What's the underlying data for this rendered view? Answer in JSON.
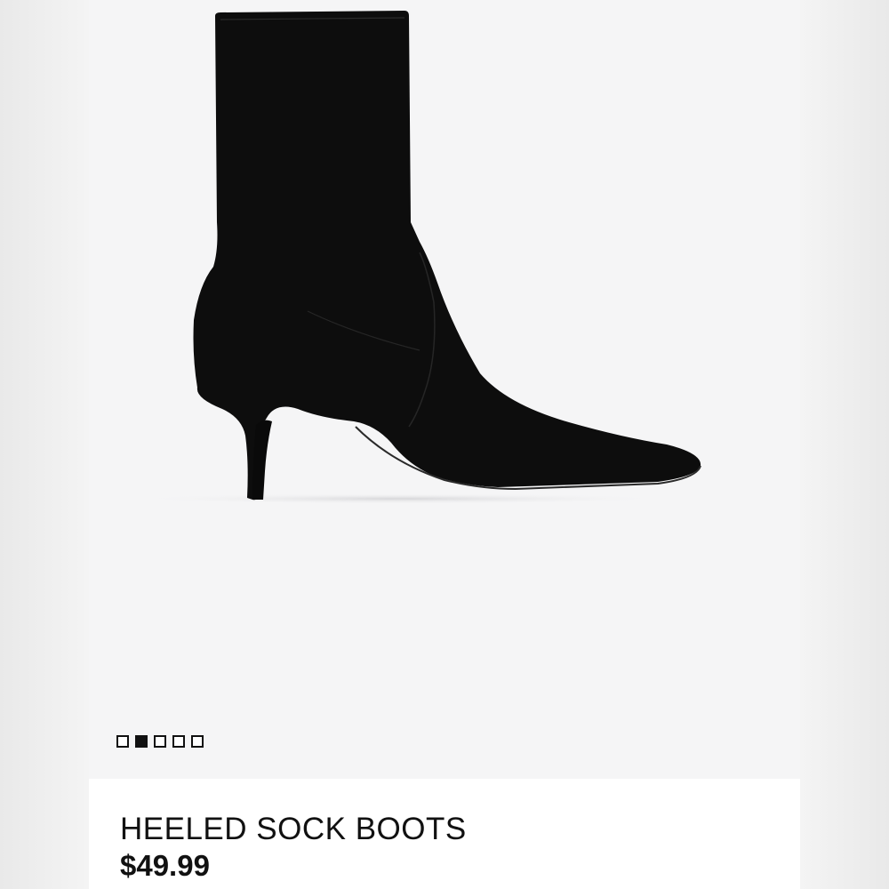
{
  "product": {
    "name": "HEELED SOCK BOOTS",
    "price": "$49.99",
    "image_alt": "Black heeled sock boot",
    "color": "#0d0d0d"
  },
  "gallery": {
    "total_images": 5,
    "active_index": 1
  }
}
